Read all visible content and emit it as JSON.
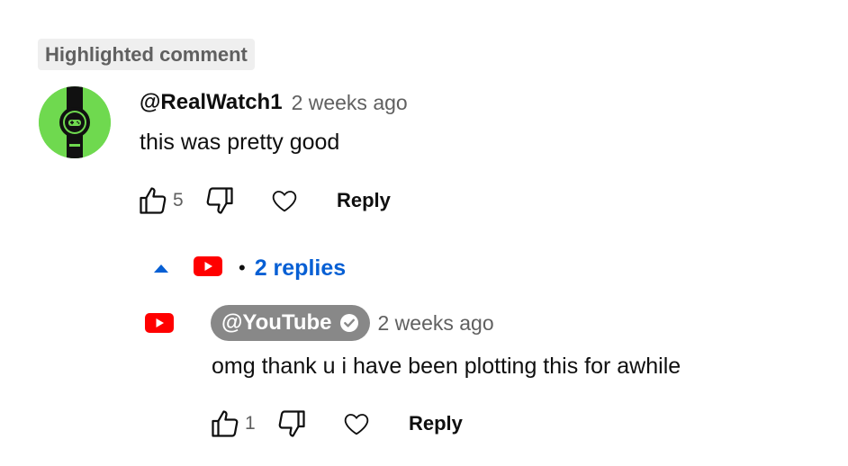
{
  "highlight_badge": "Highlighted comment",
  "comment": {
    "author": "@RealWatch1",
    "timestamp": "2 weeks ago",
    "text": "this was pretty good",
    "like_count": "5",
    "reply_label": "Reply",
    "avatar_icon": "gamepad-watch-icon"
  },
  "replies_toggle": {
    "bullet": "•",
    "label": "2 replies"
  },
  "reply": {
    "author": "@YouTube",
    "timestamp": "2 weeks ago",
    "text": "omg thank u i have been plotting this for awhile",
    "like_count": "1",
    "reply_label": "Reply",
    "avatar_icon": "youtube-logo-icon"
  },
  "colors": {
    "link_blue": "#065fd4",
    "youtube_red": "#ff0000",
    "owner_chip": "#888888",
    "avatar_green": "#6fd94f",
    "secondary_text": "#606060"
  }
}
